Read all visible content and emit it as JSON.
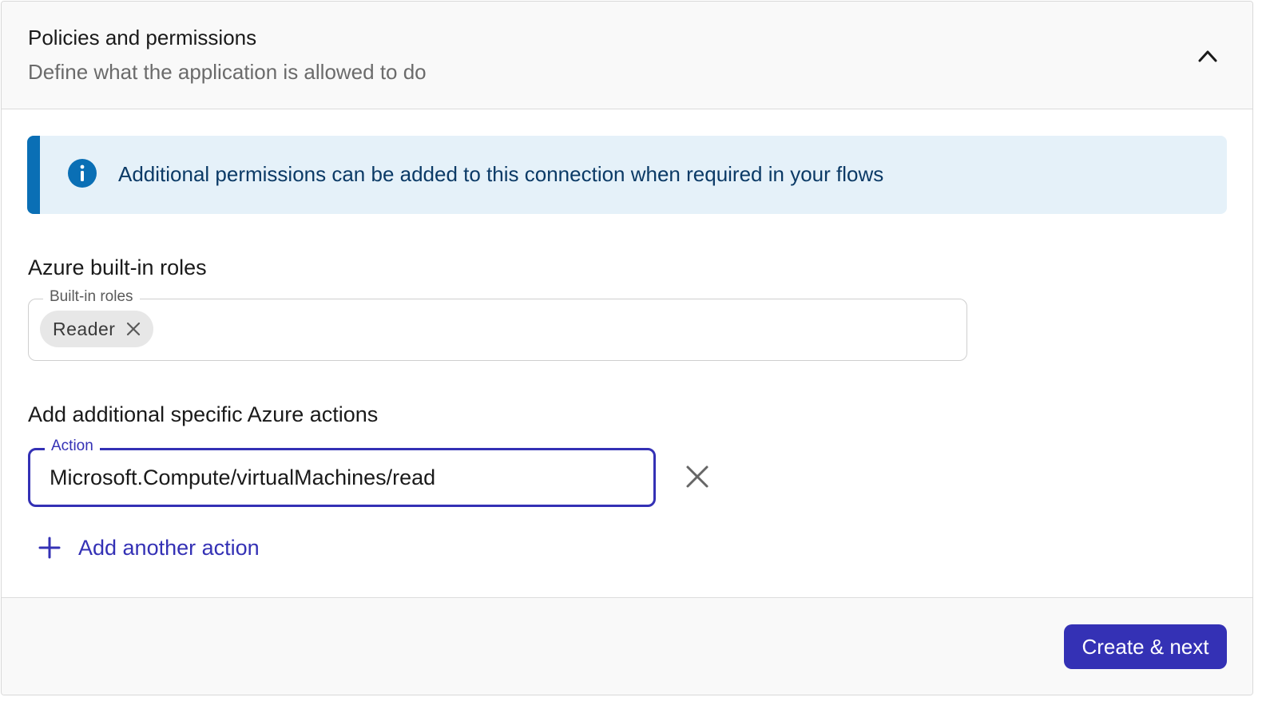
{
  "section": {
    "title": "Policies and permissions",
    "subtitle": "Define what the application is allowed to do",
    "collapse_icon": "chevron-up-icon"
  },
  "info_banner": {
    "text": "Additional permissions can be added to this connection when required in your flows",
    "icon": "info-icon",
    "accent_color": "#0a6fb5",
    "background_color": "#e5f1f9"
  },
  "builtin_roles": {
    "heading": "Azure built-in roles",
    "field_label": "Built-in roles",
    "selected": [
      {
        "label": "Reader",
        "remove_icon": "close-icon"
      }
    ]
  },
  "actions": {
    "heading": "Add additional specific Azure actions",
    "field_label": "Action",
    "value": "Microsoft.Compute/virtualMachines/read",
    "remove_icon": "close-icon",
    "add_label": "Add another action",
    "add_icon": "plus-icon"
  },
  "footer": {
    "primary_button": "Create & next"
  },
  "colors": {
    "accent": "#3431b5",
    "info_text": "#0b3a66"
  }
}
